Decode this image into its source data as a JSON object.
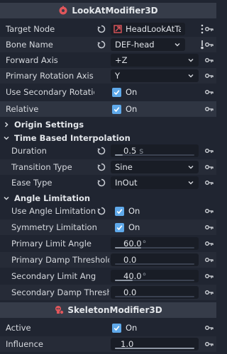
{
  "modifier1": {
    "title": "LookAtModifier3D",
    "icon": "modifier-icon",
    "props": {
      "target_node": {
        "label": "Target Node",
        "value": "HeadLookAtTar"
      },
      "bone_name": {
        "label": "Bone Name",
        "value": "DEF-head"
      },
      "forward_axis": {
        "label": "Forward Axis",
        "value": "+Z"
      },
      "primary_rotation_axis": {
        "label": "Primary Rotation Axis",
        "value": "Y"
      },
      "use_secondary_rotation": {
        "label": "Use Secondary Rotation",
        "value": "On",
        "checked": true
      },
      "relative": {
        "label": "Relative",
        "value": "On",
        "checked": true
      }
    },
    "origin_settings": {
      "label": "Origin Settings"
    },
    "time_interp": {
      "label": "Time Based Interpolation",
      "duration": {
        "label": "Duration",
        "value": "0.5",
        "suffix": "s",
        "level": 0.1
      },
      "transition_type": {
        "label": "Transition Type",
        "value": "Sine"
      },
      "ease_type": {
        "label": "Ease Type",
        "value": "InOut"
      }
    },
    "angle_limitation": {
      "label": "Angle Limitation",
      "use_angle_limitation": {
        "label": "Use Angle Limitation",
        "value": "On",
        "checked": true
      },
      "symmetry_limitation": {
        "label": "Symmetry Limitation",
        "value": "On",
        "checked": true
      },
      "primary_limit_angle": {
        "label": "Primary Limit Angle",
        "value": "60.0",
        "suffix": "°",
        "level": 0.33
      },
      "primary_damp_threshold": {
        "label": "Primary Damp Threshold",
        "value": "0.0",
        "level": 0
      },
      "secondary_limit_angle": {
        "label": "Secondary Limit Angle",
        "value": "40.0",
        "suffix": "°",
        "level": 0.22
      },
      "secondary_damp_threshold": {
        "label": "Secondary Damp Threshold",
        "value": "0.0",
        "level": 0
      }
    }
  },
  "modifier2": {
    "title": "SkeletonModifier3D",
    "icon": "skeleton-modifier-icon",
    "active": {
      "label": "Active",
      "value": "On",
      "checked": true
    },
    "influence": {
      "label": "Influence",
      "value": "1.0",
      "level": 1.0
    }
  },
  "colors": {
    "background": "#202531",
    "header": "#363c49",
    "field": "#191d26",
    "checkbox": "#5fa9ea",
    "class_icon": "#e0565b"
  }
}
